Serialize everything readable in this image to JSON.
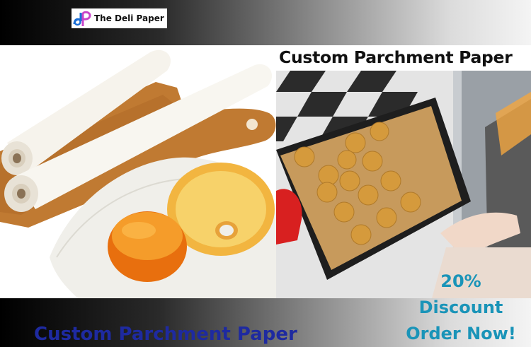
{
  "brand": {
    "name": "The Deli Paper"
  },
  "heading": "Custom Parchment Paper",
  "footer_title": "Custom Parchment Paper",
  "promo": {
    "line1": "20%",
    "line2": "Discount",
    "line3": "Order Now!"
  },
  "colors": {
    "promo": "#1a94b8",
    "footer_title": "#1e2aa0",
    "logo_blue": "#1c6fd6",
    "logo_pink": "#c944c9"
  },
  "icons": [
    "dp-logo-icon"
  ]
}
